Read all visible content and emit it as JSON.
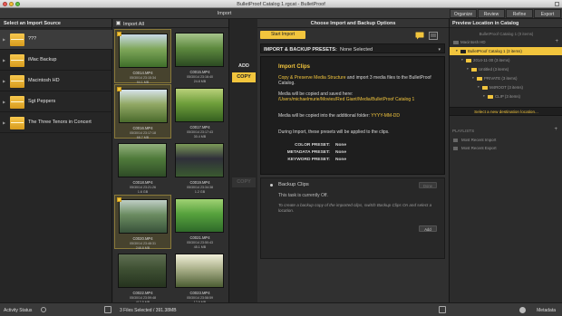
{
  "window": {
    "title": "BulletProof Catalog 1.rgcat - BulletProof",
    "colors": {
      "close": "#ee5c55",
      "minimize": "#f6be37",
      "zoom": "#5fc541"
    }
  },
  "header": {
    "import_label": "Import",
    "tabs": [
      "Organize",
      "Review",
      "Refine",
      "Export"
    ]
  },
  "source": {
    "title": "Select an Import Source",
    "items": [
      {
        "label": "???",
        "selected": true
      },
      {
        "label": "iMac Backup",
        "selected": false
      },
      {
        "label": "Macintosh HD",
        "selected": false
      },
      {
        "label": "Sgt Peppers",
        "selected": false
      },
      {
        "label": "The Three Tenors in Concert",
        "selected": false
      }
    ]
  },
  "clips": {
    "import_all_label": "Import All",
    "items": [
      {
        "name": "C0014.MP4",
        "date": "05/30/14 23:15:34",
        "size": "94.1 MB",
        "selected": true,
        "scene": "green"
      },
      {
        "name": "C0015.MP4",
        "date": "05/30/14 23:16:40",
        "size": "24.8 MB",
        "selected": false,
        "scene": "forest"
      },
      {
        "name": "C0016.MP4",
        "date": "05/30/14 23:17:18",
        "size": "68.7 MB",
        "selected": true,
        "scene": "tree"
      },
      {
        "name": "C0017.MP4",
        "date": "05/30/14 23:17:43",
        "size": "30.4 MB",
        "selected": false,
        "scene": "grass"
      },
      {
        "name": "C0018.MP4",
        "date": "05/30/14 23:21:26",
        "size": "1.6 GB",
        "selected": false,
        "scene": "trees"
      },
      {
        "name": "C0019.MP4",
        "date": "05/30/14 23:34:38",
        "size": "1.2 GB",
        "selected": false,
        "scene": "people"
      },
      {
        "name": "C0020.MP4",
        "date": "05/30/14 23:48:31",
        "size": "248.8 MB",
        "selected": true,
        "scene": "walk"
      },
      {
        "name": "C0021.MP4",
        "date": "05/30/14 23:50:43",
        "size": "45.1 MB",
        "selected": false,
        "scene": "leaf"
      },
      {
        "name": "C0022.MP4",
        "date": "05/30/14 23:59:48",
        "size": "413.5 MB",
        "selected": false,
        "scene": "dim"
      },
      {
        "name": "C0023.MP4",
        "date": "05/30/14 23:58:59",
        "size": "12.9 MB",
        "selected": false,
        "scene": "light"
      }
    ]
  },
  "modes": {
    "add": "ADD",
    "copy": "COPY",
    "copy_ghost": "COPY"
  },
  "options": {
    "title": "Choose Import and Backup Options",
    "start_label": "Start Import",
    "presets_label": "IMPORT & BACKUP PRESETS:",
    "presets_value": "None Selected",
    "copy": {
      "heading": "Import Clips",
      "line1_link": "Copy & Preserve Media Structure",
      "line1_rest": " and import 3 media files to the BulletProof Catalog.",
      "line2": "Media will be copied and saved here:",
      "path": "/Users/michaelmurie/Movies/Red Giant/Media/BulletProof Catalog 1",
      "line3": "Media will be copied into the additional folder: ",
      "folder": "YYYY-MM-DD",
      "line4": "During Import, these presets will be applied to the clips.",
      "presets": [
        {
          "label": "COLOR PRESET:",
          "value": "None"
        },
        {
          "label": "METADATA PRESET:",
          "value": "None"
        },
        {
          "label": "KEYWORD PRESET:",
          "value": "None"
        }
      ]
    },
    "backup": {
      "heading": "Backup Clips",
      "done_label": "Done",
      "status": "This task is currently Off.",
      "hint": "To create a backup copy of the imported clips, switch Backup Clips On and select a location.",
      "add_label": "Add"
    }
  },
  "preview": {
    "title": "Preview Location in Catalog",
    "root": "BulletProof Catalog 1 (0 items)",
    "drive": "Macintosh HD",
    "tree": [
      {
        "label": "BulletProof Catalog 1 (3 items)",
        "depth": 1,
        "selected": true
      },
      {
        "label": "2014-11-30 (3 items)",
        "depth": 2,
        "selected": false
      },
      {
        "label": "Untitled (3 items)",
        "depth": 3,
        "selected": false
      },
      {
        "label": "PRIVATE (3 items)",
        "depth": 4,
        "selected": false
      },
      {
        "label": "M4ROOT (3 items)",
        "depth": 5,
        "selected": false
      },
      {
        "label": "CLIP (3 items)",
        "depth": 6,
        "selected": false
      }
    ],
    "new_destination": "Select a new destination location...",
    "playlists_label": "PLAYLISTS",
    "playlists": [
      "Most Recent Import",
      "Most Recent Export"
    ]
  },
  "status": {
    "activity_label": "Activity Status",
    "summary": "3 Files Selected / 391.38MB",
    "metadata_label": "Metadata"
  }
}
